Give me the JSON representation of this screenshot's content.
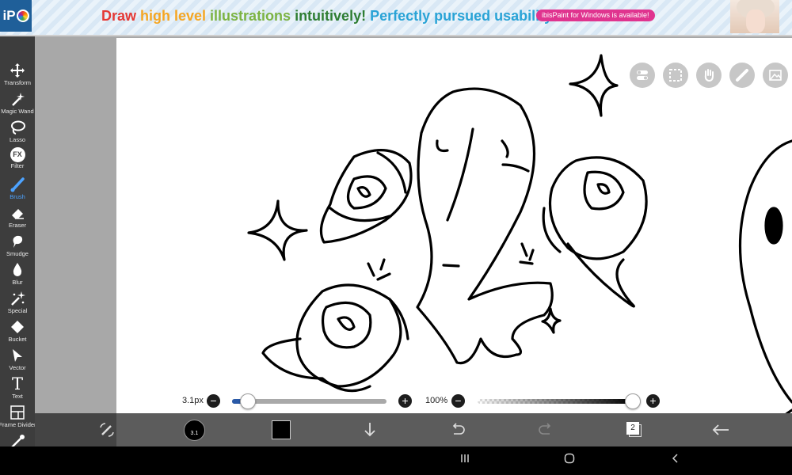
{
  "ad": {
    "logo_text": "iP",
    "headline_parts": [
      {
        "text": "Draw",
        "color": "#e53935"
      },
      {
        "text": "high level",
        "color": "#f5a623"
      },
      {
        "text": "illustrations",
        "color": "#7cb342"
      },
      {
        "text": "intuitively!",
        "color": "#2e7d32"
      },
      {
        "text": "Perfectly pursued usability!",
        "color": "#29a3d6"
      }
    ],
    "pill_text": "ibisPaint for Windows is available!",
    "pill_color": "#e0348f"
  },
  "tools": [
    {
      "label": "Transform",
      "icon": "move-icon"
    },
    {
      "label": "Magic Wand",
      "icon": "magic-wand-icon"
    },
    {
      "label": "Lasso",
      "icon": "lasso-icon"
    },
    {
      "label": "Filter",
      "icon": "fx-icon",
      "glyph": "FX"
    },
    {
      "label": "Brush",
      "icon": "brush-icon",
      "active": true
    },
    {
      "label": "Eraser",
      "icon": "eraser-icon"
    },
    {
      "label": "Smudge",
      "icon": "smudge-icon"
    },
    {
      "label": "Blur",
      "icon": "blur-drop-icon"
    },
    {
      "label": "Special",
      "icon": "sparkle-icon"
    },
    {
      "label": "Bucket",
      "icon": "bucket-icon"
    },
    {
      "label": "Vector",
      "icon": "vector-arrow-icon"
    },
    {
      "label": "Text",
      "icon": "text-icon",
      "glyph": "T"
    },
    {
      "label": "Frame Divider",
      "icon": "frame-divider-icon"
    },
    {
      "label": "",
      "icon": "eyedropper-icon"
    }
  ],
  "canvas_buttons": [
    "toggle-icon",
    "selection-icon",
    "hand-icon",
    "ruler-icon",
    "image-icon"
  ],
  "brush_size": {
    "label": "3.1px",
    "minus": "−",
    "plus": "+",
    "fraction": 0.03
  },
  "opacity": {
    "label": "100%",
    "minus": "−",
    "plus": "+",
    "fraction": 1.0
  },
  "bottom_toolbar": {
    "brush_badge": "3.1",
    "layer_count": "2",
    "active_color": "#000000",
    "accent_color": "#4da3ff"
  }
}
